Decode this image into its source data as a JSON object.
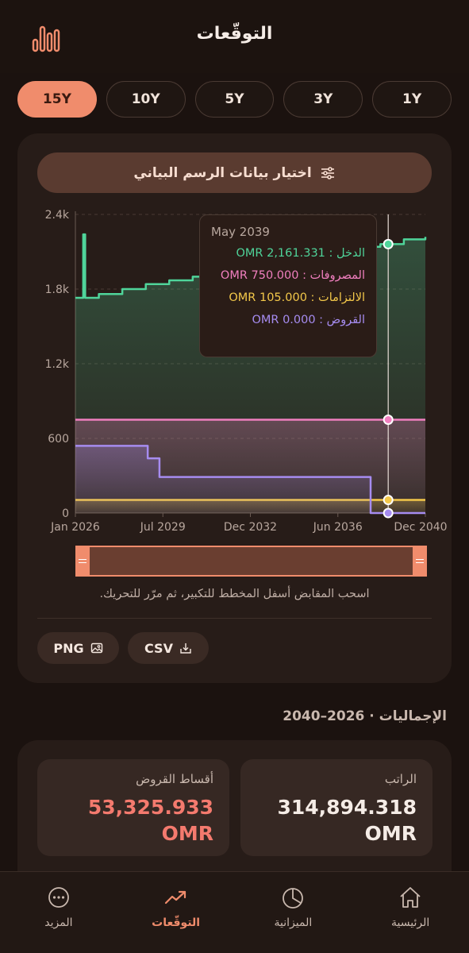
{
  "header": {
    "title": "التوقّعات",
    "logo_icon": "bar-chart-logo-icon"
  },
  "periods": [
    {
      "label": "15Y",
      "active": true
    },
    {
      "label": "10Y",
      "active": false
    },
    {
      "label": "5Y",
      "active": false
    },
    {
      "label": "3Y",
      "active": false
    },
    {
      "label": "1Y",
      "active": false
    }
  ],
  "chart_card": {
    "select_label": "اختيار بيانات الرسم البياني",
    "select_icon": "sliders-icon",
    "hint": "اسحب المقابض أسفل المخطط للتكبير، ثم مرّر للتحريك.",
    "export_png": "PNG",
    "export_csv": "CSV"
  },
  "chart_data": {
    "type": "line",
    "x_ticks": [
      "Jan 2026",
      "Jul 2029",
      "Dec 2032",
      "Jun 2036",
      "Dec 2040"
    ],
    "y_ticks": [
      "0",
      "600",
      "1.2k",
      "1.8k",
      "2.4k"
    ],
    "ylim": [
      0,
      2400
    ],
    "xlim": [
      "Jan 2026",
      "Dec 2040"
    ],
    "grid": true,
    "colors": {
      "income": "#4fd49a",
      "expenses": "#f07fbf",
      "commitments": "#f3c84a",
      "loans": "#a68cf0"
    },
    "series": [
      {
        "name": "الدخل",
        "color": "#4fd49a",
        "points": [
          [
            "Jan 2026",
            1730
          ],
          [
            "Apr 2026",
            1730
          ],
          [
            "May 2026",
            2240
          ],
          [
            "Jun 2026",
            1730
          ],
          [
            "Jan 2027",
            1760
          ],
          [
            "Jan 2028",
            1800
          ],
          [
            "Jan 2029",
            1840
          ],
          [
            "Jan 2030",
            1870
          ],
          [
            "Jan 2031",
            1900
          ],
          [
            "Jan 2032",
            1940
          ],
          [
            "Jan 2033",
            1970
          ],
          [
            "Jan 2034",
            2010
          ],
          [
            "Jan 2035",
            2050
          ],
          [
            "Jan 2036",
            2080
          ],
          [
            "Jan 2037",
            2110
          ],
          [
            "Jan 2038",
            2140
          ],
          [
            "Jan 2039",
            2161.331
          ],
          [
            "Jan 2040",
            2200
          ],
          [
            "Dec 2040",
            2220
          ]
        ]
      },
      {
        "name": "المصروفات",
        "color": "#f07fbf",
        "points": [
          [
            "Jan 2026",
            750
          ],
          [
            "Dec 2040",
            750
          ]
        ]
      },
      {
        "name": "الالتزامات",
        "color": "#f3c84a",
        "points": [
          [
            "Jan 2026",
            105
          ],
          [
            "Dec 2040",
            105
          ]
        ]
      },
      {
        "name": "القروض",
        "color": "#a68cf0",
        "points": [
          [
            "Jan 2026",
            540
          ],
          [
            "Jan 2029",
            540
          ],
          [
            "Feb 2029",
            440
          ],
          [
            "Jul 2029",
            440
          ],
          [
            "Aug 2029",
            290
          ],
          [
            "Jul 2038",
            290
          ],
          [
            "Aug 2038",
            0
          ],
          [
            "Dec 2040",
            0
          ]
        ]
      }
    ],
    "tooltip": {
      "date": "May 2039",
      "rows": [
        {
          "label": "الدخل : 2,161.331 OMR",
          "color": "#4fd49a"
        },
        {
          "label": "المصروفات : 750.000 OMR",
          "color": "#f07fbf"
        },
        {
          "label": "الالتزامات : 105.000 OMR",
          "color": "#f3c84a"
        },
        {
          "label": "القروض : 0.000 OMR",
          "color": "#a68cf0"
        }
      ]
    }
  },
  "totals": {
    "title": "الإجماليات · 2026–2040",
    "salary": {
      "label": "الراتب",
      "value": "314,894.318",
      "unit": "OMR",
      "color": "#f5ece6"
    },
    "loan_installments": {
      "label": "أقساط القروض",
      "value": "53,325.933",
      "unit": "OMR",
      "color": "#f47a6e"
    }
  },
  "nav": [
    {
      "label": "المزيد",
      "icon": "more-dots-icon",
      "active": false
    },
    {
      "label": "التوقّعات",
      "icon": "trend-icon",
      "active": true
    },
    {
      "label": "الميزانية",
      "icon": "pie-chart-icon",
      "active": false
    },
    {
      "label": "الرئيسية",
      "icon": "home-icon",
      "active": false
    }
  ]
}
